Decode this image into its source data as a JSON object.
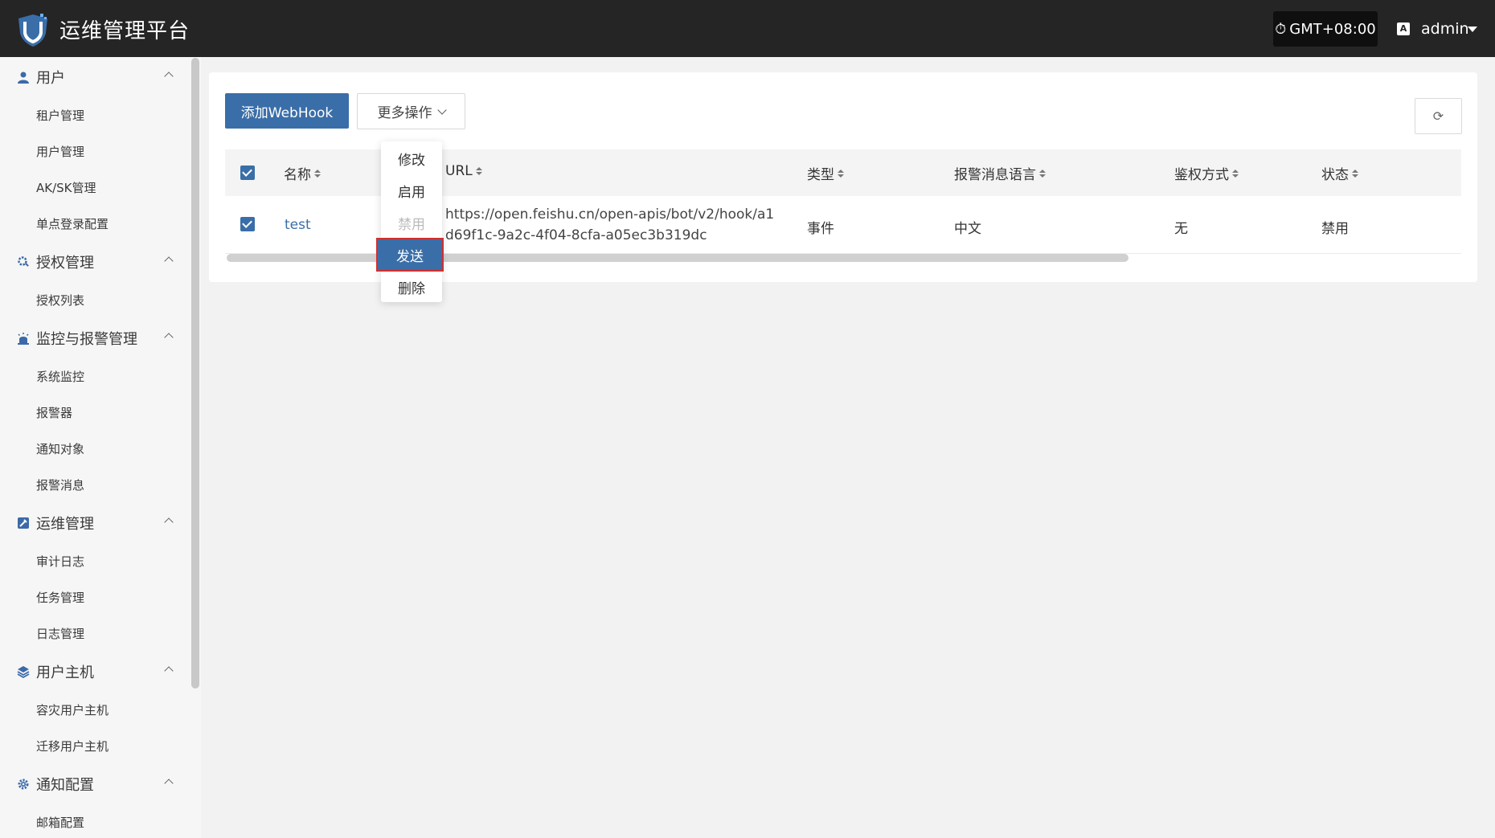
{
  "header": {
    "title": "运维管理平台",
    "timezone": "GMT+08:00",
    "user": "admin",
    "lang_icon_text": "A"
  },
  "sidebar": {
    "groups": [
      {
        "label": "用户",
        "icon": "user-icon",
        "items": [
          "租户管理",
          "用户管理",
          "AK/SK管理",
          "单点登录配置"
        ]
      },
      {
        "label": "授权管理",
        "icon": "gear-key-icon",
        "items": [
          "授权列表"
        ]
      },
      {
        "label": "监控与报警管理",
        "icon": "alarm-icon",
        "items": [
          "系统监控",
          "报警器",
          "通知对象",
          "报警消息"
        ]
      },
      {
        "label": "运维管理",
        "icon": "tools-icon",
        "items": [
          "审计日志",
          "任务管理",
          "日志管理"
        ]
      },
      {
        "label": "用户主机",
        "icon": "layers-icon",
        "items": [
          "容灾用户主机",
          "迁移用户主机"
        ]
      },
      {
        "label": "通知配置",
        "icon": "gear-icon",
        "items": [
          "邮箱配置"
        ]
      }
    ]
  },
  "toolbar": {
    "add_label": "添加WebHook",
    "more_label": "更多操作"
  },
  "table": {
    "headers": [
      "名称",
      "URL",
      "类型",
      "报警消息语言",
      "鉴权方式",
      "状态"
    ],
    "rows": [
      {
        "name": "test",
        "url": "https://open.feishu.cn/open-apis/bot/v2/hook/a1d69f1c-9a2c-4f04-8cfa-a05ec3b319dc",
        "type": "事件",
        "language": "中文",
        "auth": "无",
        "status": "禁用"
      }
    ]
  },
  "dropdown": {
    "items": [
      {
        "label": "修改",
        "state": "normal"
      },
      {
        "label": "启用",
        "state": "normal"
      },
      {
        "label": "禁用",
        "state": "disabled"
      },
      {
        "label": "发送",
        "state": "active"
      },
      {
        "label": "删除",
        "state": "normal"
      }
    ]
  },
  "colors": {
    "accent": "#3a6ea8",
    "header_bg": "#252525",
    "highlight_border": "#d03030"
  }
}
